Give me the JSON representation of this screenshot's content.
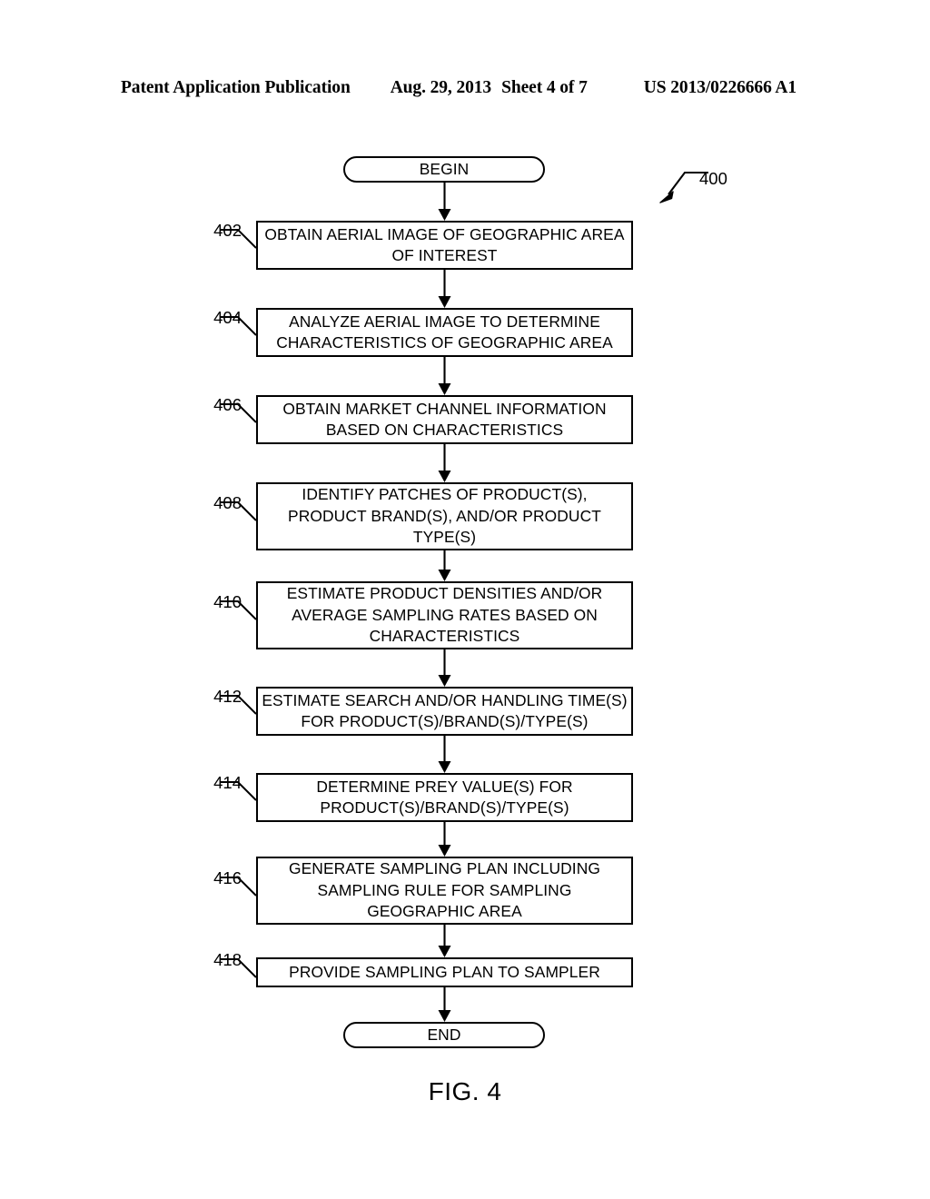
{
  "header": {
    "publication": "Patent Application Publication",
    "date": "Aug. 29, 2013",
    "sheet": "Sheet 4 of 7",
    "patent_number": "US 2013/0226666 A1"
  },
  "figure": {
    "caption": "FIG. 4",
    "callout_number": "400"
  },
  "flowchart": {
    "type": "flowchart",
    "orientation": "top-to-bottom",
    "nodes": [
      {
        "id": "begin",
        "shape": "terminator",
        "ref": "",
        "text": "BEGIN"
      },
      {
        "id": "s402",
        "shape": "process",
        "ref": "402",
        "text": "OBTAIN AERIAL IMAGE OF GEOGRAPHIC AREA OF INTEREST"
      },
      {
        "id": "s404",
        "shape": "process",
        "ref": "404",
        "text": "ANALYZE AERIAL IMAGE TO DETERMINE CHARACTERISTICS OF GEOGRAPHIC AREA"
      },
      {
        "id": "s406",
        "shape": "process",
        "ref": "406",
        "text": "OBTAIN MARKET CHANNEL INFORMATION BASED ON CHARACTERISTICS"
      },
      {
        "id": "s408",
        "shape": "process",
        "ref": "408",
        "text": "IDENTIFY PATCHES OF PRODUCT(S), PRODUCT BRAND(S), AND/OR PRODUCT TYPE(S)"
      },
      {
        "id": "s410",
        "shape": "process",
        "ref": "410",
        "text": "ESTIMATE PRODUCT DENSITIES AND/OR AVERAGE SAMPLING RATES BASED ON CHARACTERISTICS"
      },
      {
        "id": "s412",
        "shape": "process",
        "ref": "412",
        "text": "ESTIMATE SEARCH AND/OR HANDLING TIME(S) FOR PRODUCT(S)/BRAND(S)/TYPE(S)"
      },
      {
        "id": "s414",
        "shape": "process",
        "ref": "414",
        "text": "DETERMINE PREY VALUE(S) FOR PRODUCT(S)/BRAND(S)/TYPE(S)"
      },
      {
        "id": "s416",
        "shape": "process",
        "ref": "416",
        "text": "GENERATE SAMPLING PLAN INCLUDING SAMPLING RULE FOR SAMPLING GEOGRAPHIC AREA"
      },
      {
        "id": "s418",
        "shape": "process",
        "ref": "418",
        "text": "PROVIDE SAMPLING PLAN TO SAMPLER"
      },
      {
        "id": "end",
        "shape": "terminator",
        "ref": "",
        "text": "END"
      }
    ],
    "edges": [
      {
        "from": "begin",
        "to": "s402"
      },
      {
        "from": "s402",
        "to": "s404"
      },
      {
        "from": "s404",
        "to": "s406"
      },
      {
        "from": "s406",
        "to": "s408"
      },
      {
        "from": "s408",
        "to": "s410"
      },
      {
        "from": "s410",
        "to": "s412"
      },
      {
        "from": "s412",
        "to": "s414"
      },
      {
        "from": "s414",
        "to": "s416"
      },
      {
        "from": "s416",
        "to": "s418"
      },
      {
        "from": "s418",
        "to": "end"
      }
    ]
  }
}
